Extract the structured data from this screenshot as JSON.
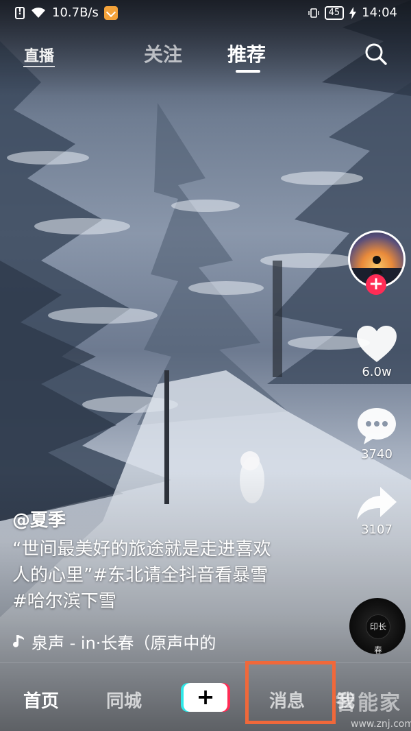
{
  "status_bar": {
    "network_speed": "10.7B/s",
    "battery": "45",
    "time": "14:04"
  },
  "top_nav": {
    "live_label": "直播",
    "tabs": [
      {
        "label": "关注",
        "active": false
      },
      {
        "label": "推荐",
        "active": true
      }
    ]
  },
  "video": {
    "author": "@夏季",
    "description_lines": [
      "“世间最美好的旅途就是走进喜欢",
      "人的心里”#东北请全抖音看暴雪",
      "#哈尔滨下雪"
    ],
    "music": "泉声 - in·长春（原声中的"
  },
  "actions": {
    "likes": "6.0w",
    "comments": "3740",
    "shares": "3107",
    "disc_label": "印长春"
  },
  "bottom_bar": {
    "home": "首页",
    "city": "同城",
    "create": "+",
    "messages": "消息",
    "me": "我"
  },
  "watermark": {
    "brand": "智能家",
    "url": "www.znj.com"
  },
  "colors": {
    "accent_red": "#ff2c55",
    "accent_cyan": "#2ee8e8",
    "highlight_orange": "#f0683a"
  }
}
